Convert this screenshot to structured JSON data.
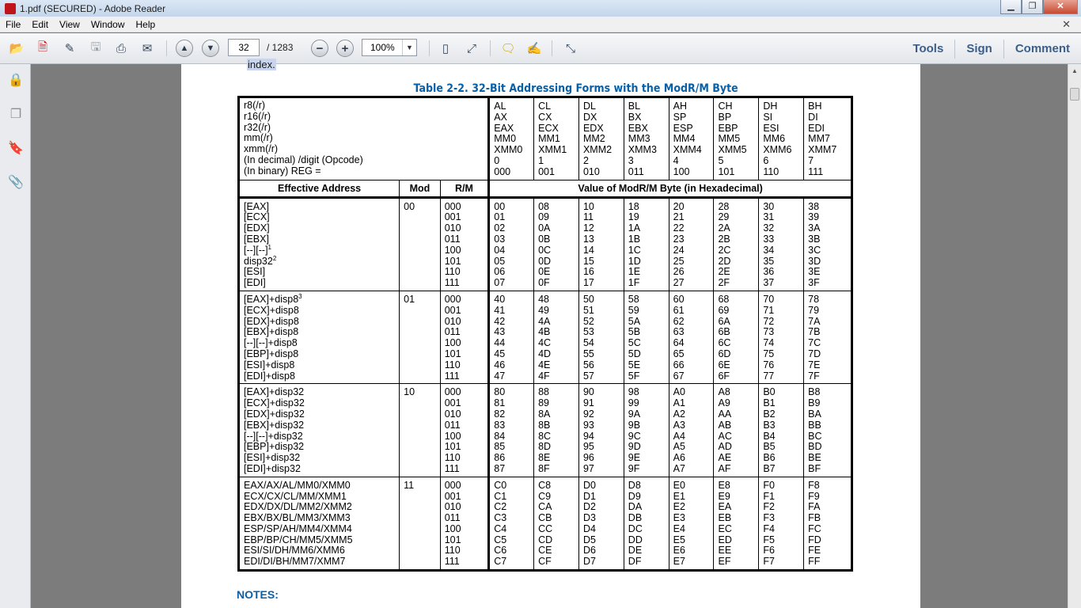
{
  "window": {
    "title": "1.pdf (SECURED) - Adobe Reader",
    "min_label": "▁",
    "max_label": "❐",
    "close_label": "✕"
  },
  "menu": {
    "items": [
      "File",
      "Edit",
      "View",
      "Window",
      "Help"
    ],
    "close_label": "✕"
  },
  "toolbar": {
    "page_current": "32",
    "page_total": "/ 1283",
    "zoom": "100%",
    "zoom_arrow": "▼",
    "tools_label": "Tools",
    "sign_label": "Sign",
    "comment_label": "Comment"
  },
  "document": {
    "index_fragment": "index.",
    "table_title": "Table 2-2.  32-Bit Addressing Forms with the ModR/M Byte",
    "header_labels": "r8(/r)\nr16(/r)\nr32(/r)\nmm(/r)\nxmm(/r)\n(In decimal) /digit (Opcode)\n(In binary) REG =",
    "reg_columns": [
      "AL\nAX\nEAX\nMM0\nXMM0\n0\n000",
      "CL\nCX\nECX\nMM1\nXMM1\n1\n001",
      "DL\nDX\nEDX\nMM2\nXMM2\n2\n010",
      "BL\nBX\nEBX\nMM3\nXMM3\n3\n011",
      "AH\nSP\nESP\nMM4\nXMM4\n4\n100",
      "CH\nBP\nEBP\nMM5\nXMM5\n5\n101",
      "DH\nSI\nESI\nMM6\nXMM6\n6\n110",
      "BH\nDI\nEDI\nMM7\nXMM7\n7\n111"
    ],
    "col_effective_address": "Effective Address",
    "col_mod": "Mod",
    "col_rm": "R/M",
    "col_value": "Value of ModR/M Byte (in Hexadecimal)",
    "groups": [
      {
        "addresses": "[EAX]\n[ECX]\n[EDX]\n[EBX]\n[--][--]\ndisp32\n[ESI]\n[EDI]",
        "mod": "00",
        "rm": "000\n001\n010\n011\n100\n101\n110\n111",
        "values": [
          "00\n01\n02\n03\n04\n05\n06\n07",
          "08\n09\n0A\n0B\n0C\n0D\n0E\n0F",
          "10\n11\n12\n13\n14\n15\n16\n17",
          "18\n19\n1A\n1B\n1C\n1D\n1E\n1F",
          "20\n21\n22\n23\n24\n25\n26\n27",
          "28\n29\n2A\n2B\n2C\n2D\n2E\n2F",
          "30\n31\n32\n33\n34\n35\n36\n37",
          "38\n39\n3A\n3B\n3C\n3D\n3E\n3F"
        ]
      },
      {
        "addresses": "[EAX]+disp8\n[ECX]+disp8\n[EDX]+disp8\n[EBX]+disp8\n[--][--]+disp8\n[EBP]+disp8\n[ESI]+disp8\n[EDI]+disp8",
        "mod": "01",
        "rm": "000\n001\n010\n011\n100\n101\n110\n111",
        "values": [
          "40\n41\n42\n43\n44\n45\n46\n47",
          "48\n49\n4A\n4B\n4C\n4D\n4E\n4F",
          "50\n51\n52\n53\n54\n55\n56\n57",
          "58\n59\n5A\n5B\n5C\n5D\n5E\n5F",
          "60\n61\n62\n63\n64\n65\n66\n67",
          "68\n69\n6A\n6B\n6C\n6D\n6E\n6F",
          "70\n71\n72\n73\n74\n75\n76\n77",
          "78\n79\n7A\n7B\n7C\n7D\n7E\n7F"
        ]
      },
      {
        "addresses": "[EAX]+disp32\n[ECX]+disp32\n[EDX]+disp32\n[EBX]+disp32\n[--][--]+disp32\n[EBP]+disp32\n[ESI]+disp32\n[EDI]+disp32",
        "mod": "10",
        "rm": "000\n001\n010\n011\n100\n101\n110\n111",
        "values": [
          "80\n81\n82\n83\n84\n85\n86\n87",
          "88\n89\n8A\n8B\n8C\n8D\n8E\n8F",
          "90\n91\n92\n93\n94\n95\n96\n97",
          "98\n99\n9A\n9B\n9C\n9D\n9E\n9F",
          "A0\nA1\nA2\nA3\nA4\nA5\nA6\nA7",
          "A8\nA9\nAA\nAB\nAC\nAD\nAE\nAF",
          "B0\nB1\nB2\nB3\nB4\nB5\nB6\nB7",
          "B8\nB9\nBA\nBB\nBC\nBD\nBE\nBF"
        ]
      },
      {
        "addresses": "EAX/AX/AL/MM0/XMM0\nECX/CX/CL/MM/XMM1\nEDX/DX/DL/MM2/XMM2\nEBX/BX/BL/MM3/XMM3\nESP/SP/AH/MM4/XMM4\nEBP/BP/CH/MM5/XMM5\nESI/SI/DH/MM6/XMM6\nEDI/DI/BH/MM7/XMM7",
        "mod": "11",
        "rm": "000\n001\n010\n011\n100\n101\n110\n111",
        "values": [
          "C0\nC1\nC2\nC3\nC4\nC5\nC6\nC7",
          "C8\nC9\nCA\nCB\nCC\nCD\nCE\nCF",
          "D0\nD1\nD2\nD3\nD4\nD5\nD6\nD7",
          "D8\nD9\nDA\nDB\nDC\nDD\nDE\nDF",
          "E0\nE1\nE2\nE3\nE4\nE5\nE6\nE7",
          "E8\nE9\nEA\nEB\nEC\nED\nEE\nEF",
          "F0\nF1\nF2\nF3\nF4\nF5\nF6\nF7",
          "F8\nF9\nFA\nFB\nFC\nFD\nFE\nFF"
        ]
      }
    ],
    "footnote_1": "1",
    "footnote_2": "2",
    "footnote_3": "3",
    "notes_label": "NOTES:"
  },
  "icons": {
    "open": "open-folder-icon",
    "create": "create-pdf-icon",
    "edit": "edit-icon",
    "save": "save-icon",
    "print": "print-icon",
    "email": "email-icon",
    "prev": "prev-page-icon",
    "next": "next-page-icon",
    "zoom_out": "zoom-out-icon",
    "zoom_in": "zoom-in-icon",
    "fit_page": "fit-page-icon",
    "fit_width": "fit-width-icon",
    "comment": "comment-icon",
    "highlight": "highlight-icon",
    "fullscreen": "fullscreen-icon"
  },
  "colors": {
    "accent_blue": "#0860a8",
    "tools_text": "#3b5f8a"
  }
}
